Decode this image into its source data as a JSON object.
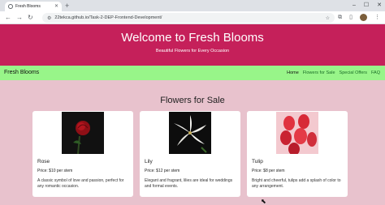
{
  "browser": {
    "tab_title": "Fresh Blooms",
    "url": "22tekca.github.io/Task-2-DEP-Frontend-Development/"
  },
  "hero": {
    "title": "Welcome to Fresh Blooms",
    "subtitle": "Beautiful Flowers for Every Occasion"
  },
  "navbar": {
    "brand": "Fresh Blooms",
    "links": [
      "Home",
      "Flowers for Sale",
      "Special Offers",
      "FAQ"
    ]
  },
  "section": {
    "title": "Flowers for Sale"
  },
  "cards": [
    {
      "name": "Rose",
      "price": "Price: $10 per stem",
      "description": "A classic symbol of love and passion, perfect for any romantic occasion."
    },
    {
      "name": "Lily",
      "price": "Price: $12 per stem",
      "description": "Elegant and fragrant, lilies are ideal for weddings and formal events."
    },
    {
      "name": "Tulip",
      "price": "Price: $8 per stem",
      "description": "Bright and cheerful, tulips add a splash of color to any arrangement."
    }
  ],
  "colors": {
    "hero_bg": "#c5205a",
    "navbar_bg": "#98f589",
    "page_bg": "#e8c2cd"
  },
  "icons": [
    "tab-favicon-icon",
    "close-icon",
    "new-tab-icon",
    "back-icon",
    "forward-icon",
    "reload-icon",
    "site-info-icon",
    "star-icon",
    "extensions-icon",
    "menu-icon"
  ]
}
